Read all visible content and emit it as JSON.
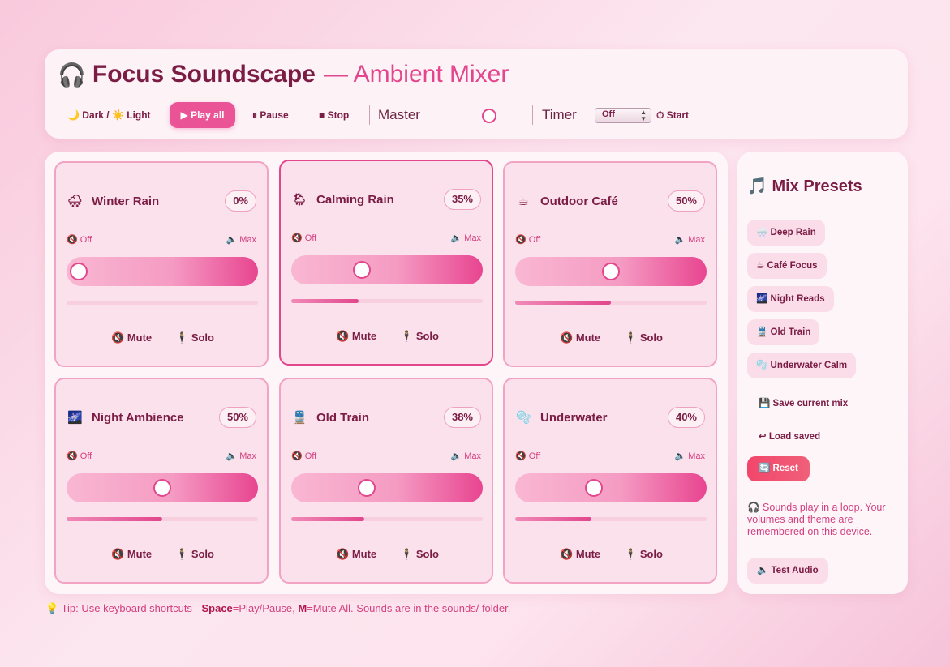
{
  "header": {
    "icon": "🎧",
    "title": "Focus Soundscape",
    "subtitle": "— Ambient Mixer",
    "theme_toggle": "🌙 Dark / ☀️ Light",
    "play_all": "▶ Play all",
    "pause": "⏸ Pause",
    "stop": "■ Stop",
    "master_label": "Master",
    "master_level": 0.5,
    "timer_label": "Timer",
    "timer_value": "Off",
    "start": "⏱ Start"
  },
  "channels": [
    {
      "icon": "🌨",
      "name": "Winter Rain",
      "percent": "0%",
      "level": 0.0,
      "off": "Off",
      "max": "Max",
      "mute": "Mute",
      "solo": "Solo"
    },
    {
      "icon": "🌦",
      "name": "Calming Rain",
      "percent": "35%",
      "level": 0.35,
      "off": "Off",
      "max": "Max",
      "mute": "Mute",
      "solo": "Solo"
    },
    {
      "icon": "☕",
      "name": "Outdoor Café",
      "percent": "50%",
      "level": 0.5,
      "off": "Off",
      "max": "Max",
      "mute": "Mute",
      "solo": "Solo"
    },
    {
      "icon": "🌌",
      "name": "Night Ambience",
      "percent": "50%",
      "level": 0.5,
      "off": "Off",
      "max": "Max",
      "mute": "Mute",
      "solo": "Solo"
    },
    {
      "icon": "🚆",
      "name": "Old Train",
      "percent": "38%",
      "level": 0.38,
      "off": "Off",
      "max": "Max",
      "mute": "Mute",
      "solo": "Solo"
    },
    {
      "icon": "🫧",
      "name": "Underwater",
      "percent": "40%",
      "level": 0.4,
      "off": "Off",
      "max": "Max",
      "mute": "Mute",
      "solo": "Solo"
    }
  ],
  "icons": {
    "mute": "🔇",
    "speaker": "🔈",
    "solo": "🕴"
  },
  "presets": {
    "title": "🎵 Mix Presets",
    "items": [
      "🌨️ Deep Rain",
      "☕ Café Focus",
      "🌌 Night Reads",
      "🚆 Old Train",
      "🫧 Underwater Calm"
    ],
    "save": "💾 Save current mix",
    "load": "↩ Load saved",
    "reset": "🔄 Reset",
    "note": "🎧 Sounds play in a loop. Your volumes and theme are remembered on this device.",
    "test_audio": "🔈 Test Audio"
  },
  "tip": {
    "prefix": "💡 Tip: Use keyboard shortcuts - ",
    "key1": "Space",
    "desc1": "=Play/Pause, ",
    "key2": "M",
    "desc2": "=Mute All. Sounds are in the sounds/ folder."
  },
  "colors": {
    "accent": "#e2468c",
    "text": "#7a1c44",
    "reset": "#f2466a"
  }
}
